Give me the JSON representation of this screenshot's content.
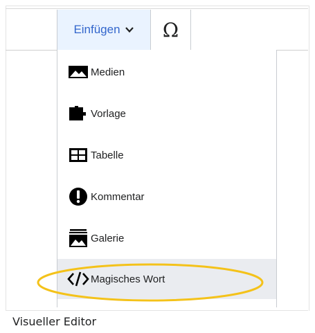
{
  "toolbar": {
    "insert_label": "Einfügen",
    "insert_icon": "chevron-down-icon",
    "special_char_label": "Ω"
  },
  "menu": {
    "items": [
      {
        "label": "Medien",
        "icon": "image-icon"
      },
      {
        "label": "Vorlage",
        "icon": "puzzle-icon"
      },
      {
        "label": "Tabelle",
        "icon": "table-icon"
      },
      {
        "label": "Kommentar",
        "icon": "exclamation-icon"
      },
      {
        "label": "Galerie",
        "icon": "gallery-icon"
      },
      {
        "label": "Magisches Wort",
        "icon": "code-icon",
        "highlighted": true
      }
    ]
  },
  "caption": "Visueller Editor",
  "colors": {
    "accent": "#3366cc",
    "highlight_oval": "#f4c21a",
    "active_bg": "#eaecf0"
  }
}
